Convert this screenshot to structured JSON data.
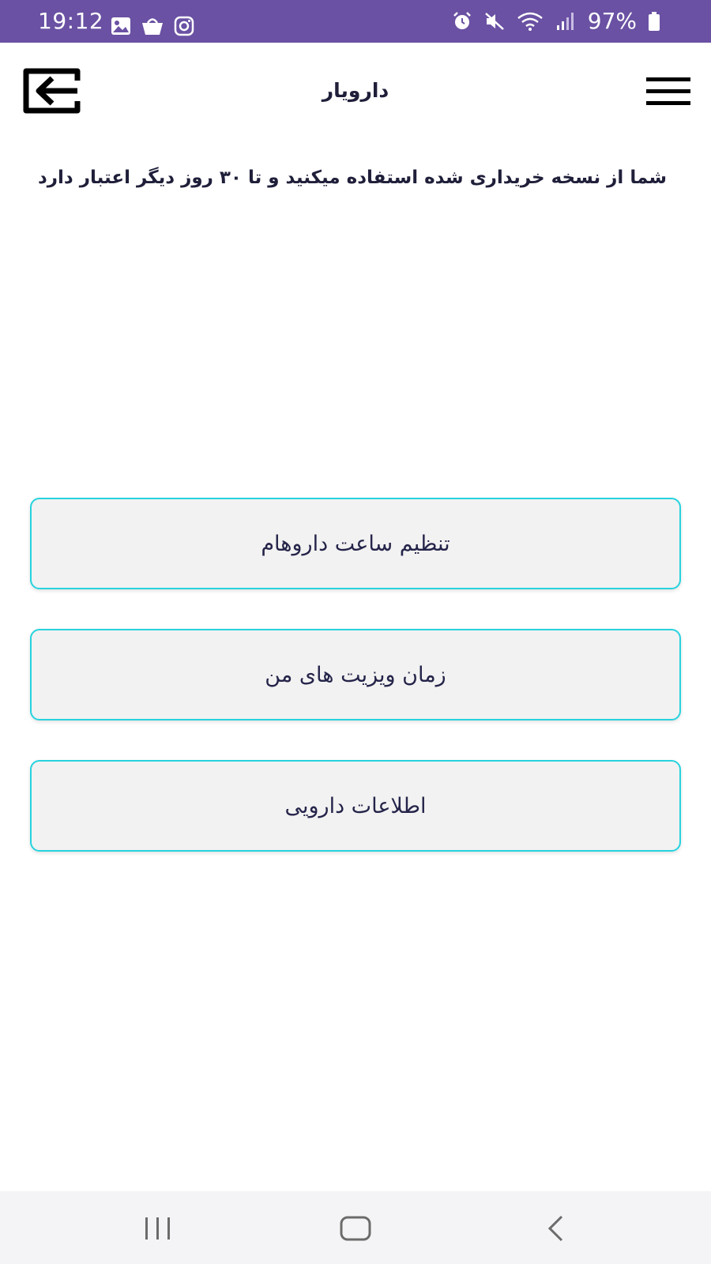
{
  "status_bar": {
    "time": "19:12",
    "battery": "97%",
    "background_color": "#6a51a3",
    "left_icons": [
      "gallery-icon",
      "shopping-bag-icon",
      "instagram-icon"
    ],
    "right_icons": [
      "alarm-icon",
      "mute-icon",
      "wifi-icon",
      "signal-icon",
      "battery-icon"
    ]
  },
  "app_bar": {
    "title": "دارویار",
    "exit_icon": "exit-icon",
    "menu_icon": "hamburger-menu-icon"
  },
  "notice": "شما از نسخه خریداری شده استفاده میکنید و تا ۳۰ روز دیگر اعتبار دارد",
  "menu": {
    "items": [
      {
        "label": "تنظیم ساعت داروهام"
      },
      {
        "label": "زمان ویزیت های من"
      },
      {
        "label": "اطلاعات دارویی"
      }
    ],
    "border_color": "#27d3df",
    "background_color": "#f2f2f2"
  },
  "nav_bar": {
    "items": [
      "recent-apps-icon",
      "home-icon",
      "back-icon"
    ]
  }
}
